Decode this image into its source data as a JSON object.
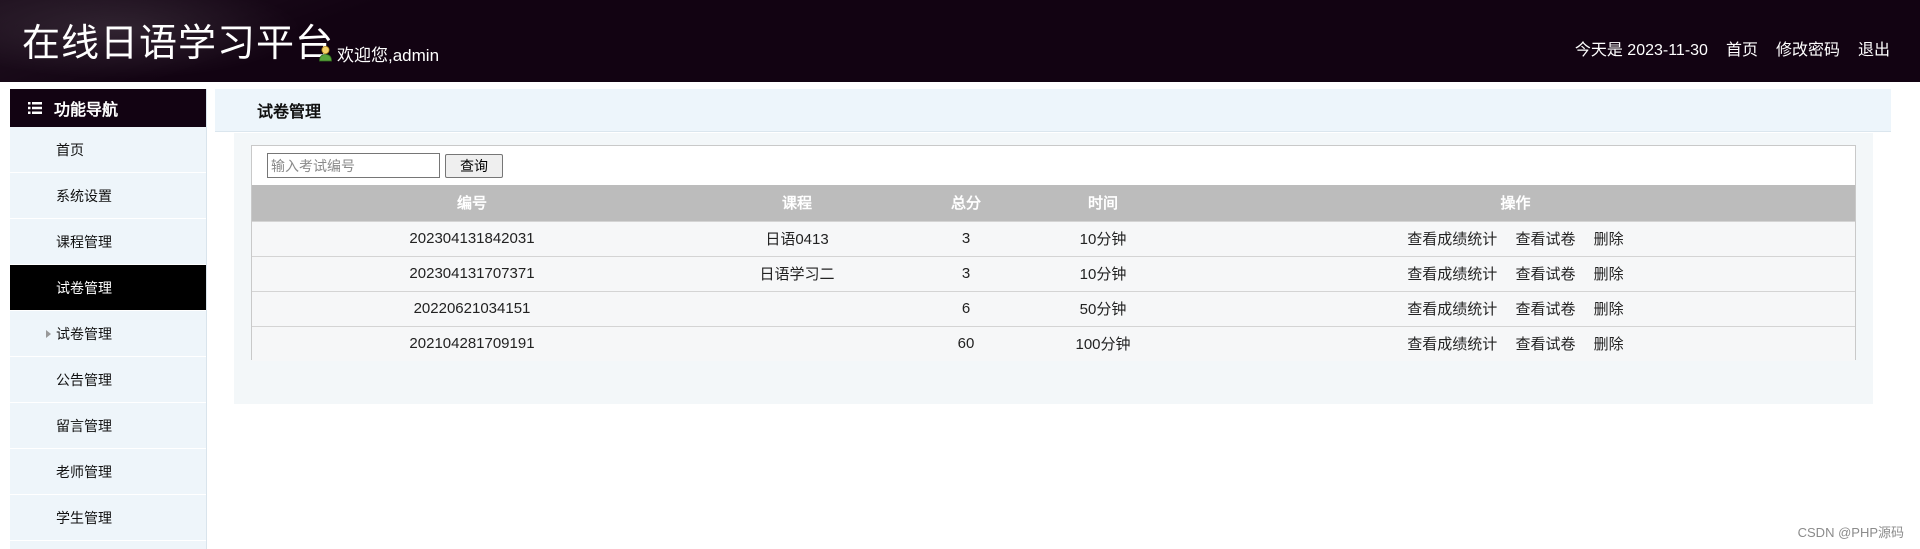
{
  "header": {
    "site_title": "在线日语学习平台",
    "welcome": "欢迎您,admin",
    "date_text": "今天是 2023-11-30",
    "home_link": "首页",
    "change_password_link": "修改密码",
    "logout_link": "退出"
  },
  "sidebar": {
    "title": "功能导航",
    "items": [
      {
        "label": "首页",
        "active": false
      },
      {
        "label": "系统设置",
        "active": false
      },
      {
        "label": "课程管理",
        "active": false
      },
      {
        "label": "试卷管理",
        "active": true
      },
      {
        "label": "试卷管理",
        "sub": true
      },
      {
        "label": "公告管理",
        "active": false
      },
      {
        "label": "留言管理",
        "active": false
      },
      {
        "label": "老师管理",
        "active": false
      },
      {
        "label": "学生管理",
        "active": false
      }
    ]
  },
  "page": {
    "title": "试卷管理",
    "search_placeholder": "输入考试编号",
    "search_button": "查询"
  },
  "table": {
    "columns": [
      "编号",
      "课程",
      "总分",
      "时间",
      "操作"
    ],
    "rows": [
      {
        "id": "202304131842031",
        "course": "日语0413",
        "total": "3",
        "time": "10分钟"
      },
      {
        "id": "202304131707371",
        "course": "日语学习二",
        "total": "3",
        "time": "10分钟"
      },
      {
        "id": "20220621034151",
        "course": "",
        "total": "6",
        "time": "50分钟"
      },
      {
        "id": "202104281709191",
        "course": "",
        "total": "60",
        "time": "100分钟"
      }
    ],
    "actions": {
      "stats": "查看成绩统计",
      "view": "查看试卷",
      "delete": "删除"
    }
  },
  "watermark": "CSDN @PHP源码",
  "colors": {
    "header_bg": "#120312",
    "active_item_bg": "#000000",
    "table_header_bg": "#bcbcbc"
  }
}
